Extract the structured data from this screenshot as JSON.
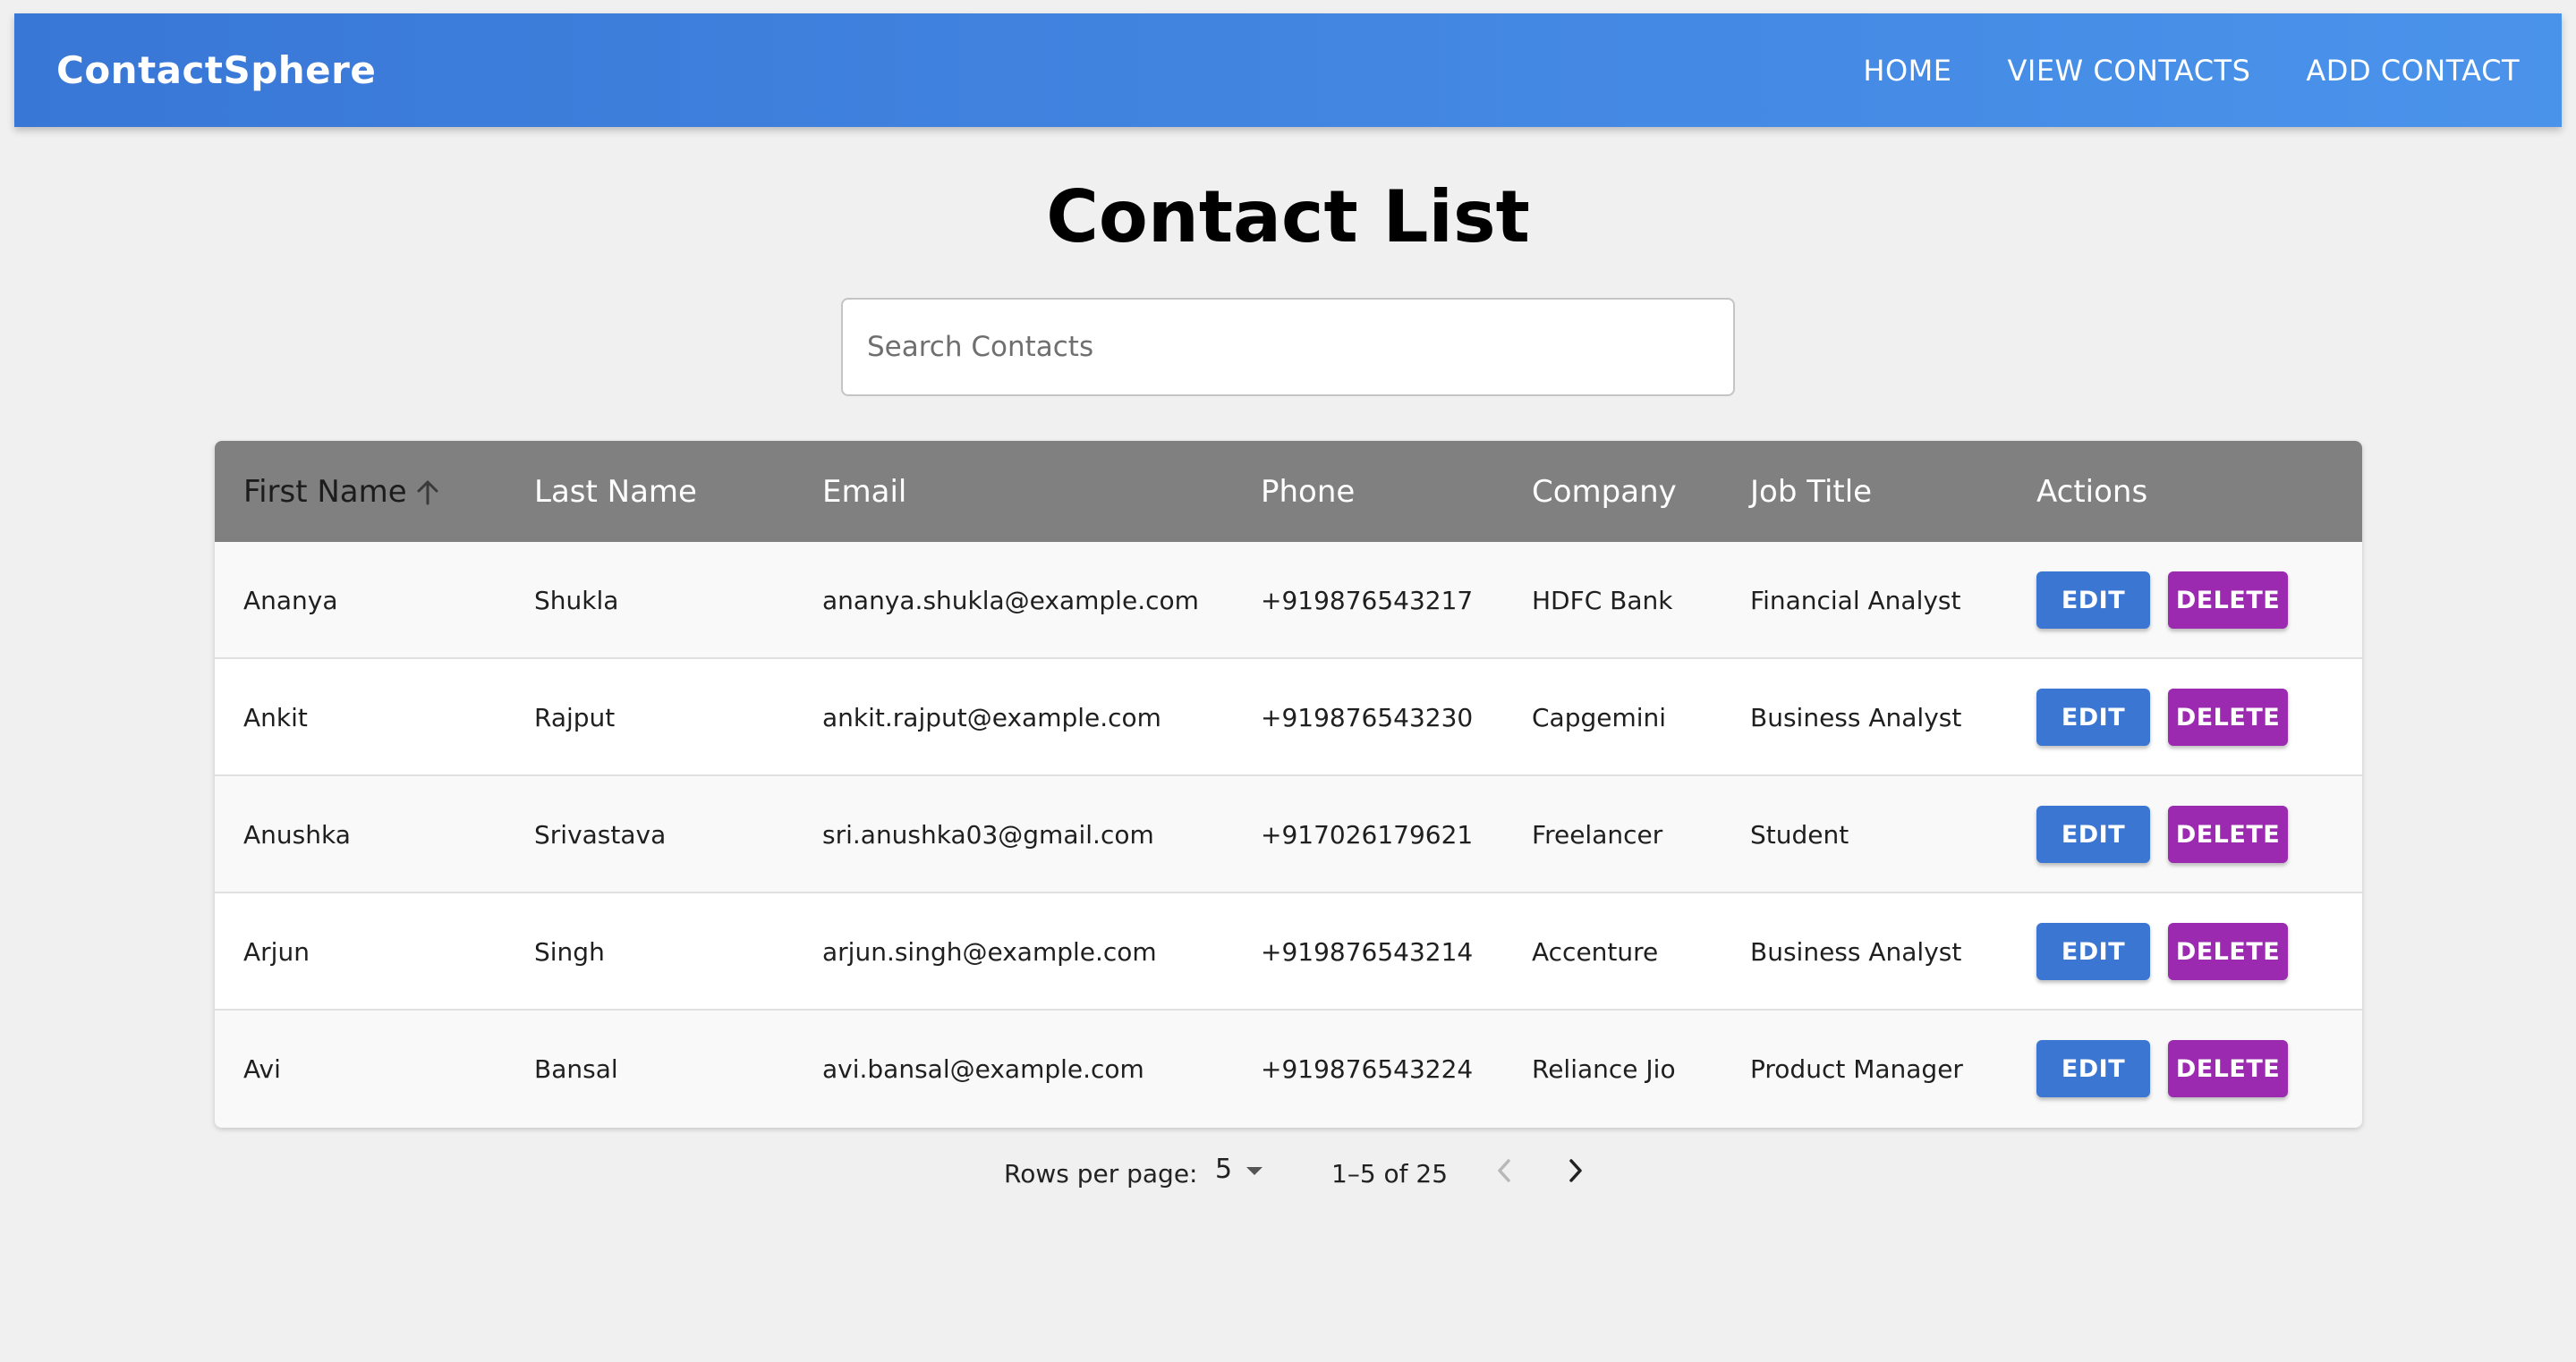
{
  "header": {
    "brand": "ContactSphere",
    "nav": [
      "HOME",
      "VIEW CONTACTS",
      "ADD CONTACT"
    ]
  },
  "page": {
    "title": "Contact List",
    "search_placeholder": "Search Contacts",
    "search_value": ""
  },
  "table": {
    "columns": [
      "First Name",
      "Last Name",
      "Email",
      "Phone",
      "Company",
      "Job Title",
      "Actions"
    ],
    "sorted_column": "First Name",
    "sort_direction": "ascending",
    "rows": [
      {
        "first": "Ananya",
        "last": "Shukla",
        "email": "ananya.shukla@example.com",
        "phone": "+919876543217",
        "company": "HDFC Bank",
        "job": "Financial Analyst"
      },
      {
        "first": "Ankit",
        "last": "Rajput",
        "email": "ankit.rajput@example.com",
        "phone": "+919876543230",
        "company": "Capgemini",
        "job": "Business Analyst"
      },
      {
        "first": "Anushka",
        "last": "Srivastava",
        "email": "sri.anushka03@gmail.com",
        "phone": "+917026179621",
        "company": "Freelancer",
        "job": "Student"
      },
      {
        "first": "Arjun",
        "last": "Singh",
        "email": "arjun.singh@example.com",
        "phone": "+919876543214",
        "company": "Accenture",
        "job": "Business Analyst"
      },
      {
        "first": "Avi",
        "last": "Bansal",
        "email": "avi.bansal@example.com",
        "phone": "+919876543224",
        "company": "Reliance Jio",
        "job": "Product Manager"
      }
    ],
    "edit_label": "EDIT",
    "delete_label": "DELETE"
  },
  "pagination": {
    "rows_per_page_label": "Rows per page:",
    "rows_per_page": "5",
    "range": "1–5 of 25",
    "prev_icon": "chevron-left-icon",
    "next_icon": "chevron-right-icon"
  },
  "colors": {
    "appbar_start": "#3977d6",
    "appbar_end": "#4a93eb",
    "table_header": "#808080",
    "edit": "#3a76d2",
    "delete": "#9c2ab0",
    "background": "#f0f0f0"
  }
}
